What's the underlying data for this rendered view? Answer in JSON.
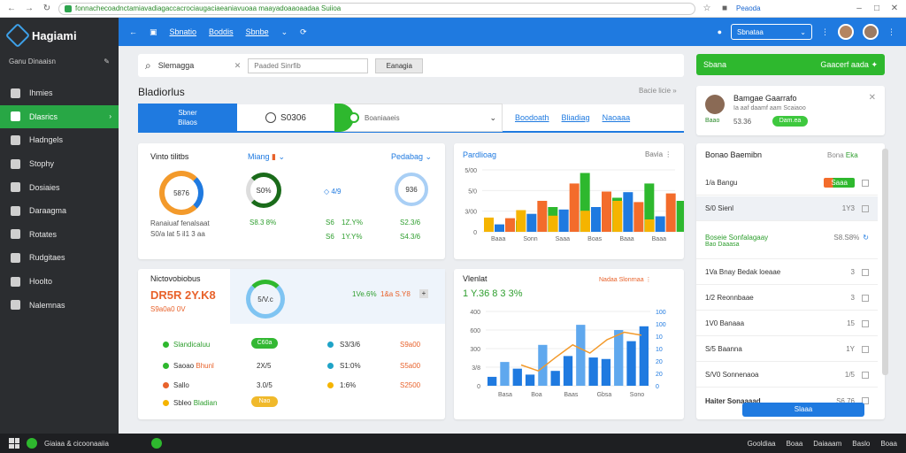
{
  "browser": {
    "url": "fonnachecoadnctamiavadiagaccacrociaugaciaeaniavuoaa maayadoaaoaadaa Suiioa",
    "bookmark_label": "Peaoda"
  },
  "sidebar": {
    "brand": "Hagiami",
    "user": "Ganu Dinaaisn",
    "items": [
      {
        "label": "Ihmies"
      },
      {
        "label": "Dlasrics"
      },
      {
        "label": "Hadngels"
      },
      {
        "label": "Stophy"
      },
      {
        "label": "Dosiaies"
      },
      {
        "label": "Daraagma"
      },
      {
        "label": "Rotates"
      },
      {
        "label": "Rudgitaes"
      },
      {
        "label": "Hoolto"
      },
      {
        "label": "Nalemnas"
      }
    ]
  },
  "topbar": {
    "tabs": [
      "Sbnatio",
      "Boddis",
      "Sbnbe"
    ],
    "select_label": "Sbnataa"
  },
  "search": {
    "value": "Slemagga",
    "filter_placeholder": "Paaded Sinrfib",
    "filter_button": "Eanagia"
  },
  "green_button": {
    "left": "Sbana",
    "right": "Gaacerf aada"
  },
  "section": {
    "title": "Bladiorlus",
    "link": "Bacie licie"
  },
  "filter_tabs": {
    "primary_line1": "Sbner",
    "primary_line2": "Bilaos",
    "time": "S0306",
    "dropdown": "Boaniaaeis",
    "links": [
      "Boodoath",
      "Bliadiag",
      "Naoaaa"
    ]
  },
  "notification": {
    "title": "Bamgae Gaarrafo",
    "subtitle": "Ia aaf daamf aam Scaiaoo",
    "badge": "Baao",
    "date": "53.36",
    "pill": "Dam.ea"
  },
  "metrics_card": {
    "title": "Vinto tilitbs",
    "tab_a": "Miang",
    "tab_b": "Pedabag",
    "ring1": "5876",
    "ring2": "S0%",
    "ring3": "936",
    "mid_value": "4/9",
    "caption1": "Ranaiuaf fenalsaat",
    "caption2": "S0/a lat 5 il1 3 aa",
    "v1": "S8.3 8%",
    "v2a": "S6",
    "v2b": "1Z.Y%",
    "v3": "S2.3/6",
    "v4a": "S6",
    "v4b": "1Y.Y%",
    "v5": "S4.3/6",
    "colors": {
      "orange": "#f39a2b",
      "blue": "#1f7ae0",
      "green": "#2e9e2e"
    }
  },
  "bar_card": {
    "title": "Pardlioag",
    "link": "Bavia"
  },
  "summary_card": {
    "title": "Nictovobiobus",
    "big": "DR5R 2Y.K8",
    "sub": "S9a0a0 0V",
    "ring": "5/V.c",
    "green_stat": "1Ve.6%",
    "orange_stat": "1&a S.Y8",
    "rows": [
      {
        "label": "Slandicaluu",
        "pill": "C60a",
        "pct": "S3/3/6",
        "amt": "S9a00"
      },
      {
        "label": "Saoao",
        "label2": "Bhunl",
        "mid": "2X/5",
        "pct": "S1:0%",
        "amt": "S5a00"
      },
      {
        "label": "Sallo",
        "mid": "3.0/5",
        "pct": "1:6%",
        "amt": "S2500"
      },
      {
        "label": "Sbleo",
        "label2": "Bladian",
        "pill": "Nao",
        "pct": "",
        "amt": ""
      }
    ]
  },
  "line_card": {
    "title": "Vlenlat",
    "big": "1 Y.36 8 3 3%",
    "legend": "Nadaa Slonrnaa"
  },
  "list_card": {
    "title": "Bonao Baemibn",
    "link": "Bona",
    "link2": "Eka",
    "rows": [
      {
        "label": "1/a Bangu",
        "pill": "Saaa"
      },
      {
        "label": "S/0 Sienl",
        "value": "1Y3"
      },
      {
        "label": "Boseie Sonfalagaay",
        "sub": "Bao Daaasa",
        "value": "S8.S8%"
      },
      {
        "label": "1Va Bnay Bedak loeaae",
        "value": "3"
      },
      {
        "label": "1/2 Reonnbaae",
        "value": "3"
      },
      {
        "label": "1V0 Banaaa",
        "value": "15"
      },
      {
        "label": "S/5 Baanna",
        "value": "1Y"
      },
      {
        "label": "S/V0 Sonnenaoa",
        "value": "1/5"
      },
      {
        "label": "Haiter Sonaaaad",
        "value": "S6.76"
      }
    ],
    "bottom_button": "Slaaa"
  },
  "chart_data": [
    {
      "type": "bar",
      "title": "Pardlioag",
      "y_ticks": [
        "5/00",
        "5/0",
        "3/00",
        "0"
      ],
      "categories": [
        "Baaa",
        "Sonn",
        "Saaa",
        "Boas",
        "Baaa",
        "Baaa"
      ],
      "series": [
        {
          "values": [
            23,
            35,
            26,
            34,
            50,
            20
          ]
        },
        {
          "values": [
            12,
            29,
            36,
            40,
            64,
            25
          ]
        },
        {
          "values": [
            22,
            50,
            78,
            65,
            48,
            62
          ]
        },
        {
          "values": [
            18,
            40,
            95,
            55,
            78,
            50
          ]
        }
      ],
      "colors": [
        "#f5b400",
        "#1f7ae0",
        "#f36c2b",
        "#2eb82e"
      ]
    },
    {
      "type": "bar",
      "title": "Vlenlat",
      "y_ticks": [
        "400",
        "600",
        "300",
        "3/8",
        "0"
      ],
      "y2_ticks": [
        "100",
        "100",
        "10",
        "10",
        "20",
        "20",
        "0"
      ],
      "categories": [
        "Basa",
        "Boa",
        "Baas",
        "Gbsa",
        "Sono"
      ],
      "series": [
        {
          "values": [
            12,
            32,
            23,
            15,
            55,
            20,
            40,
            82,
            38,
            36,
            75,
            60,
            80
          ]
        }
      ],
      "line_values": [
        28,
        20,
        38,
        55,
        44,
        62,
        72,
        68
      ],
      "colors": [
        "#1f7ae0",
        "#f39a2b"
      ]
    }
  ],
  "taskbar": {
    "left_label": "Giaiaa & cicoonaaiia",
    "right_items": [
      "Gooldiaa",
      "Boaa",
      "Daiaaam",
      "Baslo",
      "Boaa"
    ]
  }
}
